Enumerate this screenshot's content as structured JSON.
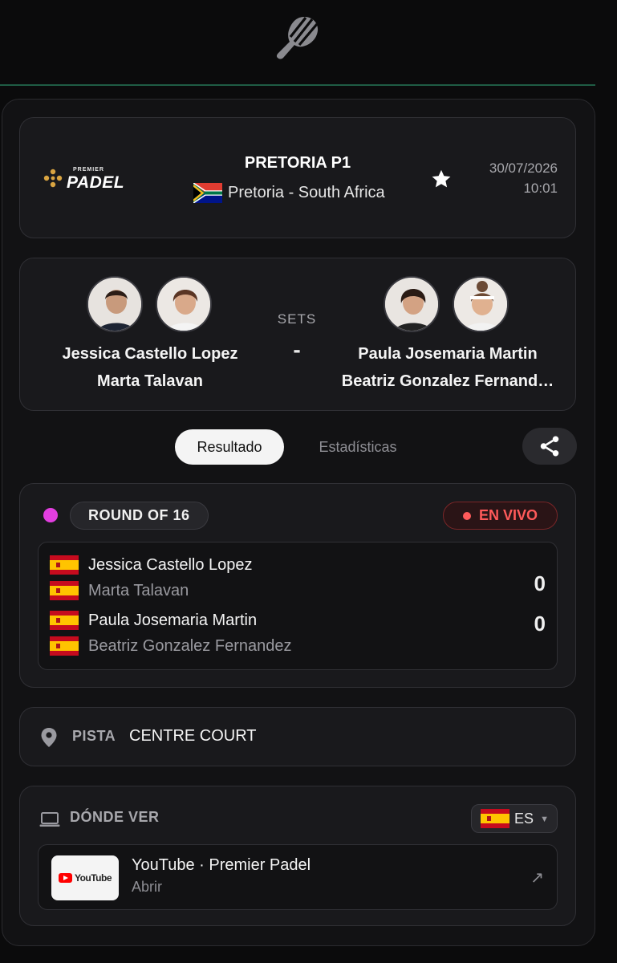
{
  "header": {
    "brand_small": "PREMIER",
    "brand_big": "PADEL",
    "tournament": "PRETORIA P1",
    "location": "Pretoria - South Africa",
    "date": "30/07/2026",
    "time": "10:01"
  },
  "match": {
    "team1": [
      "Jessica Castello Lopez",
      "Marta Talavan"
    ],
    "team2": [
      "Paula Josemaria Martin",
      "Beatriz Gonzalez Fernand…"
    ],
    "sets_label": "SETS",
    "sets_value": "-"
  },
  "tabs": {
    "result": "Resultado",
    "stats": "Estadísticas"
  },
  "result": {
    "round": "ROUND OF 16",
    "live": "EN VIVO",
    "rows": [
      "Jessica Castello Lopez",
      "Marta Talavan",
      "Paula Josemaria Martin",
      "Beatriz Gonzalez Fernandez"
    ],
    "scores": [
      "0",
      "0"
    ]
  },
  "court": {
    "label": "PISTA",
    "value": "CENTRE COURT"
  },
  "watch": {
    "label": "DÓNDE VER",
    "country": "ES",
    "provider_logo": "YouTube",
    "provider": "YouTube · Premier Padel",
    "action": "Abrir",
    "arrow": "↗"
  },
  "colors": {
    "accent_line": "#1f5c44",
    "live_red": "#ff5a5a",
    "live_dot": "#e23ee0"
  },
  "icons": [
    "padel-racket-icon",
    "star-icon",
    "share-icon",
    "location-pin-icon",
    "laptop-icon",
    "external-link-icon"
  ]
}
